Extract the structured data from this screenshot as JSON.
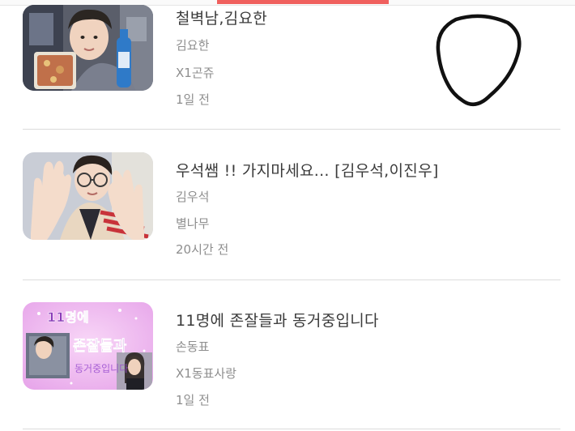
{
  "posts": [
    {
      "title": "철벽남,김요한",
      "author": "김요한",
      "category": "X1곤쥬",
      "time": "1일 전",
      "thumbnail_icon": "photo-person-holding-drink"
    },
    {
      "title": "우석쌤 !! 가지마세요...  [김우석,이진우]",
      "author": "김우석",
      "category": "별나무",
      "time": "20시간 전",
      "thumbnail_icon": "photo-person-waving"
    },
    {
      "title": "11명에 존잘들과 동거중입니다",
      "author": "손동표",
      "category": "X1동표사랑",
      "time": "1일 전",
      "thumbnail_icon": "cover-art-purple",
      "thumbnail_text": {
        "line1": "11명에",
        "line2": "존잘들과",
        "line3": "동거중입니다"
      }
    }
  ],
  "colors": {
    "title": "#3a3a3a",
    "meta": "#8e8e8e",
    "divider": "#dcdcdc",
    "accent": "#f0605e"
  }
}
